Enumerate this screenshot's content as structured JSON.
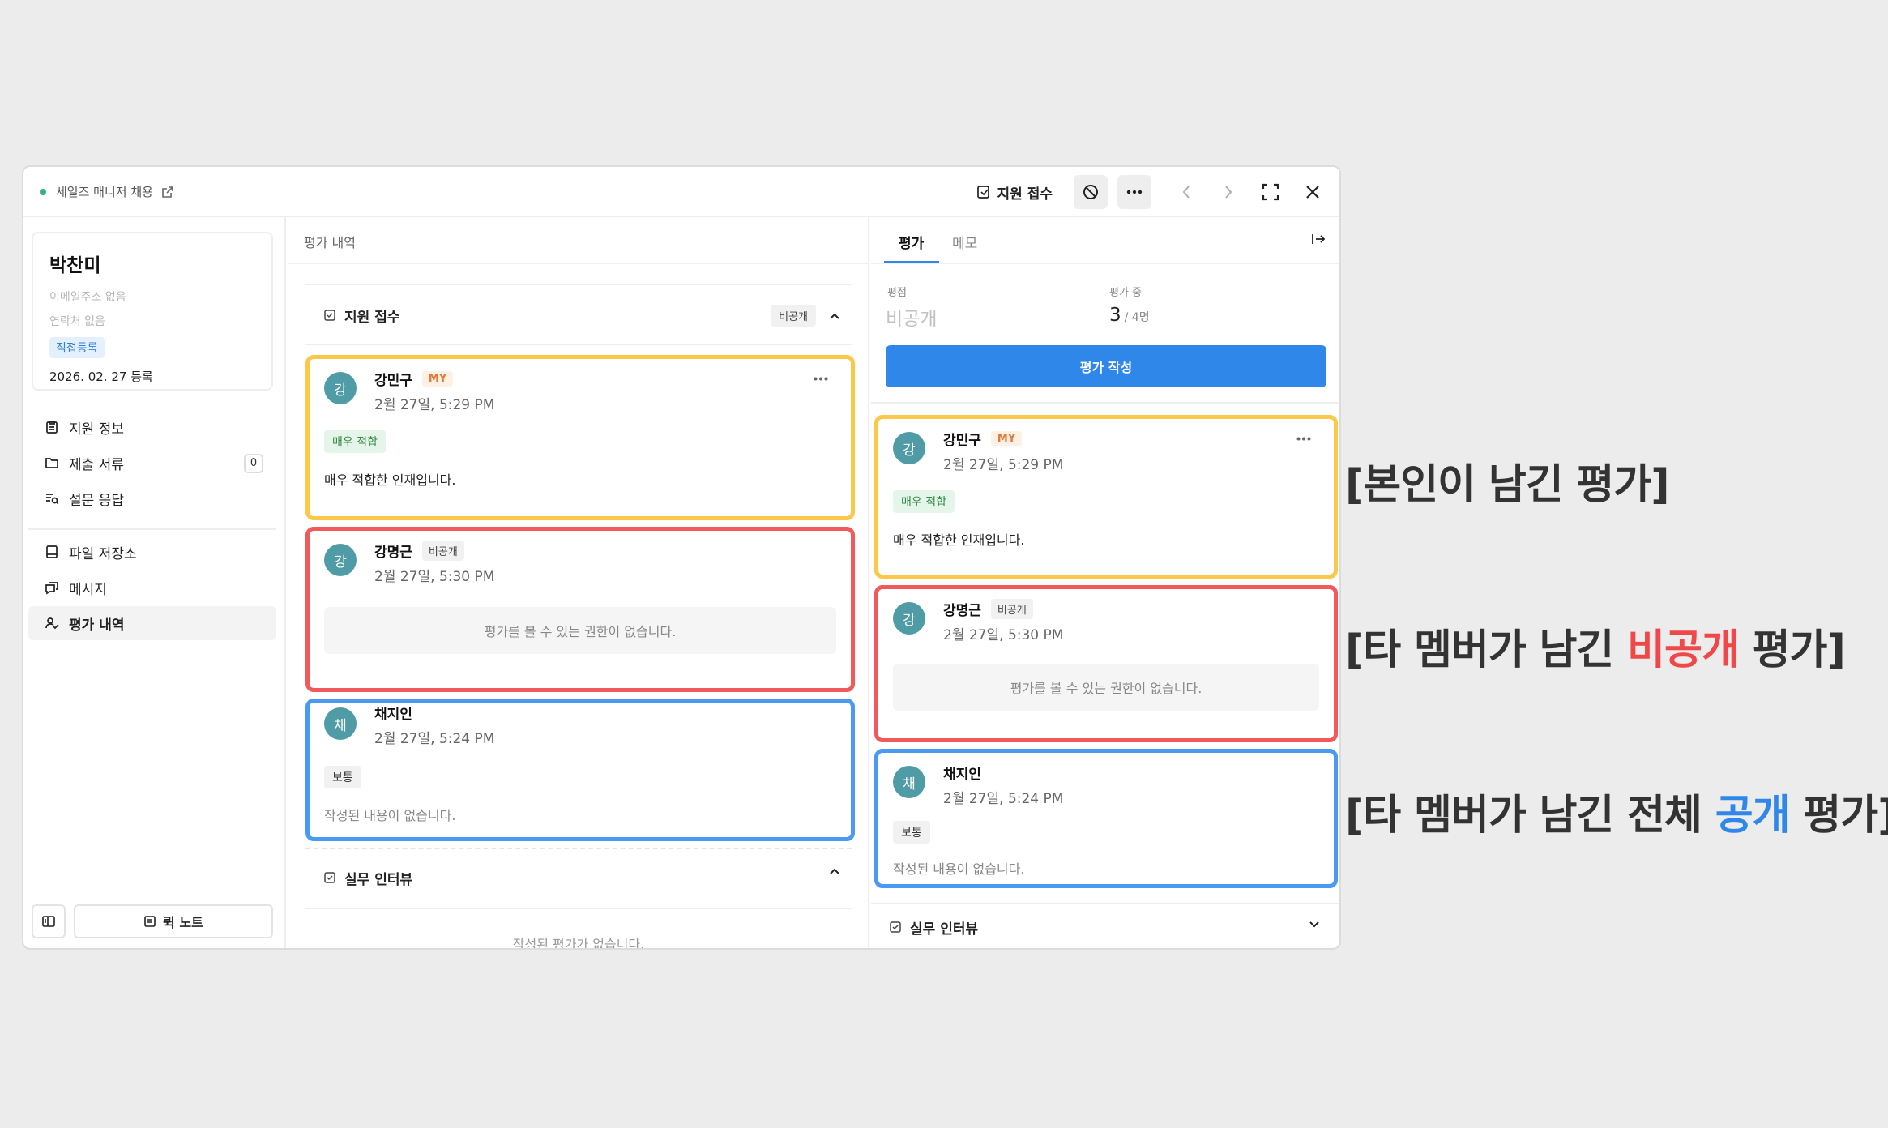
{
  "topbar": {
    "job_title": "세일즈 매니저 채용",
    "stage_label": "지원 접수"
  },
  "profile": {
    "name": "박찬미",
    "email": "이메일주소 없음",
    "phone": "연락처 없음",
    "tag": "직접등록",
    "registered": "2026. 02. 27 등록"
  },
  "sidebar": {
    "items": [
      {
        "label": "지원 정보"
      },
      {
        "label": "제출 서류",
        "count": "0"
      },
      {
        "label": "설문 응답"
      },
      {
        "label": "파일 저장소"
      },
      {
        "label": "메시지"
      },
      {
        "label": "평가 내역"
      }
    ],
    "quick_note": "퀵 노트"
  },
  "middle": {
    "header": "평가 내역",
    "section1": {
      "title": "지원 접수",
      "visibility": "비공개"
    },
    "section2": {
      "title": "실무 인터뷰",
      "empty": "작성된 평가가 없습니다."
    }
  },
  "evaluations": [
    {
      "initial": "강",
      "name": "강민구",
      "tag": "MY",
      "time": "2월 27일, 5:29 PM",
      "rating": "매우 적합",
      "text": "매우 적합한 인재입니다."
    },
    {
      "initial": "강",
      "name": "강명근",
      "tag": "비공개",
      "time": "2월 27일, 5:30 PM",
      "no_permission": "평가를 볼 수 있는 권한이 없습니다."
    },
    {
      "initial": "채",
      "name": "채지인",
      "time": "2월 27일, 5:24 PM",
      "rating": "보통",
      "text": "작성된 내용이 없습니다."
    }
  ],
  "right": {
    "tabs": [
      {
        "label": "평가"
      },
      {
        "label": "메모"
      }
    ],
    "score_label": "평점",
    "score_value": "비공개",
    "progress_label": "평가 중",
    "progress_value": "3",
    "progress_total": "/ 4명",
    "write_button": "평가 작성",
    "section2_title": "실무 인터뷰"
  },
  "annotations": {
    "a1": "[본인이 남긴 평가]",
    "a2_pre": "[타 멤버가 남긴 ",
    "a2_hl": "비공개",
    "a2_post": " 평가]",
    "a3_pre": "[타 멤버가 남긴 전체 ",
    "a3_hl": "공개",
    "a3_post": " 평가]"
  },
  "colors": {
    "accent": "#2f87ea",
    "yellow_outline": "#fcc84a",
    "red_outline": "#f05a5a",
    "blue_outline": "#4a99f2",
    "avatar": "#4f9ba6"
  }
}
